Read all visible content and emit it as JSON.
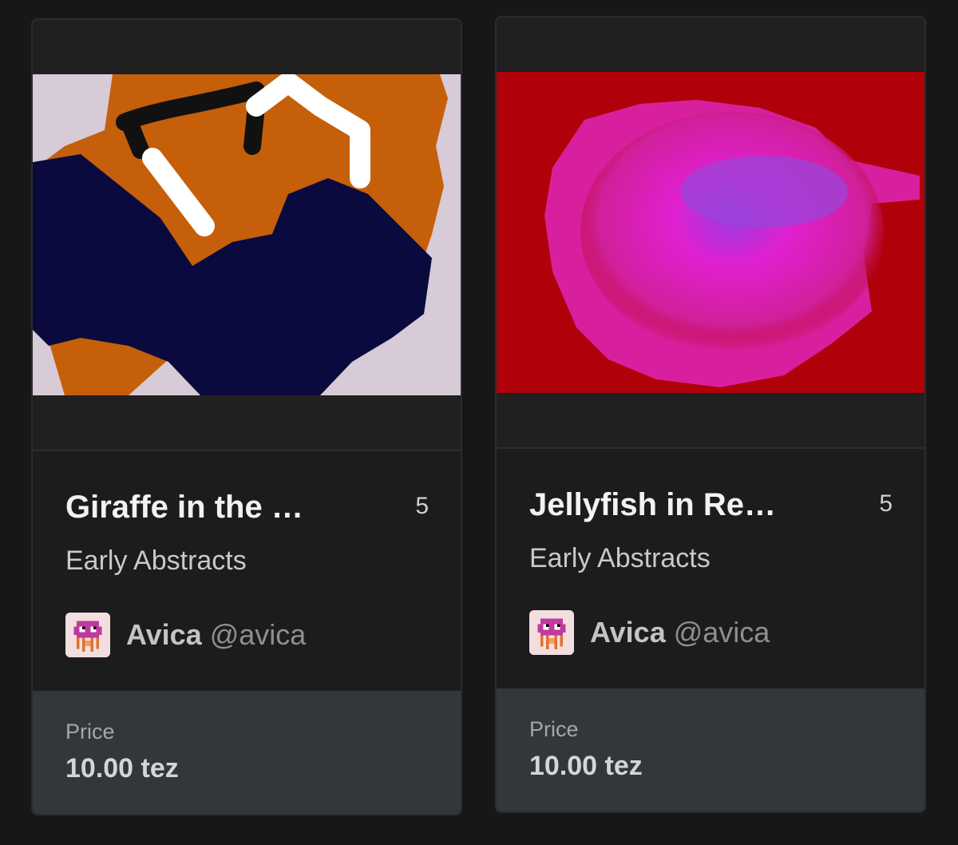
{
  "cards": [
    {
      "title": "Giraffe in the …",
      "edition_count": "5",
      "collection": "Early Abstracts",
      "creator": {
        "name": "Avica",
        "handle": "@avica",
        "avatar_icon": "jellyfish-avatar-icon"
      },
      "price": {
        "label": "Price",
        "value": "10.00 tez"
      },
      "artwork": {
        "description_colors": [
          "#c65f0a",
          "#0a0a3e",
          "#d6cbd6",
          "#ffffff",
          "#111111"
        ]
      }
    },
    {
      "title": "Jellyfish in Re…",
      "edition_count": "5",
      "collection": "Early Abstracts",
      "creator": {
        "name": "Avica",
        "handle": "@avica",
        "avatar_icon": "jellyfish-avatar-icon"
      },
      "price": {
        "label": "Price",
        "value": "10.00 tez"
      },
      "artwork": {
        "description_colors": [
          "#b0000a",
          "#e020d0",
          "#9e3ae0"
        ]
      }
    }
  ]
}
